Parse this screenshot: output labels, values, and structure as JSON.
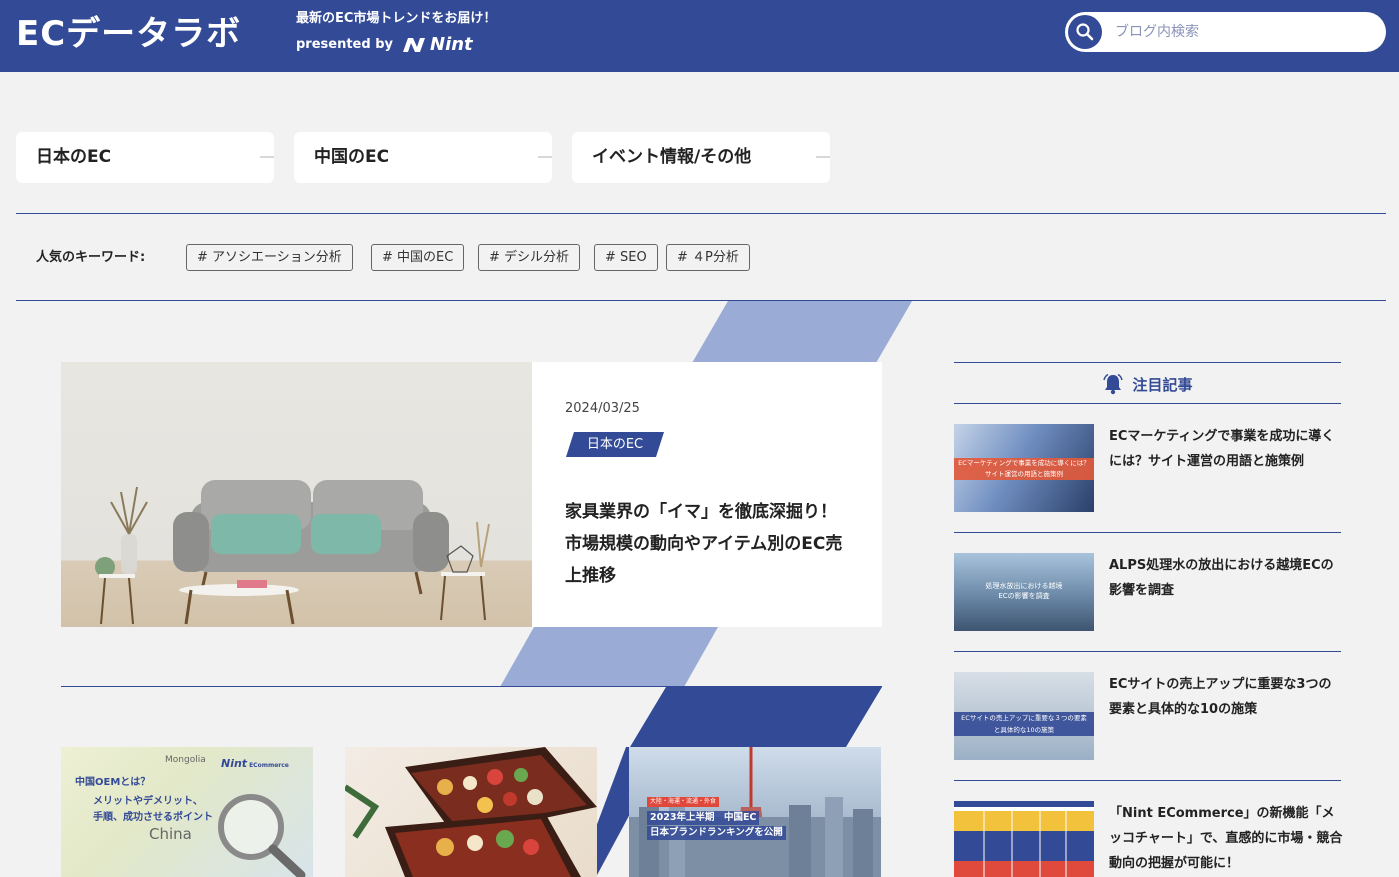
{
  "header": {
    "logo": "ECデータラボ",
    "tagline": "最新のEC市場トレンドをお届け！",
    "presented_by": "presented by",
    "partner": "Nint",
    "search_placeholder": "ブログ内検索"
  },
  "categories": [
    "日本のEC",
    "中国のEC",
    "イベント情報/その他"
  ],
  "keywords": {
    "label": "人気のキーワード:",
    "tags": [
      "# アソシエーション分析",
      "# 中国のEC",
      "# デシル分析",
      "# SEO",
      "# ４P分析"
    ]
  },
  "featured": {
    "date": "2024/03/25",
    "category": "日本のEC",
    "title": "家具業界の「イマ」を徹底深掘り！市場規模の動向やアイテム別のEC売上推移"
  },
  "sidebar": {
    "heading": "注目記事",
    "articles": [
      {
        "title": "ECマーケティングで事業を成功に導くには？サイト運営の用語と施策例",
        "thumb_text": "ECマーケティングで事業を成功に導くには？サイト運営の用語と施策例"
      },
      {
        "title": "ALPS処理水の放出における越境ECの影響を調査",
        "thumb_text": "処理水放出における越境ECの影響を調査"
      },
      {
        "title": "ECサイトの売上アップに重要な3つの要素と具体的な10の施策",
        "thumb_text": "ECサイトの売上アップに重要な３つの要素と具体的な10の施策"
      },
      {
        "title": "「Nint ECommerce」の新機能「メッコチャート」で、直感的に市場・競合動向の把握が可能に！",
        "thumb_text": ""
      }
    ]
  },
  "cards": [
    {
      "line1": "中国OEMとは？",
      "line2": "メリットやデメリット、",
      "line3": "手順、成功させるポイント",
      "map_top": "Mongolia",
      "map_mid": "China",
      "brand": "Nint",
      "brand_sub": "ECommerce"
    },
    {},
    {
      "badge": "大陸・海運・流通・外食",
      "line1": "2023年上半期　中国EC",
      "line2": "日本ブランドランキングを公開"
    }
  ],
  "colors": {
    "brand": "#334a96",
    "stripe_light": "#9aabd6",
    "bg": "#f2f2f2"
  }
}
